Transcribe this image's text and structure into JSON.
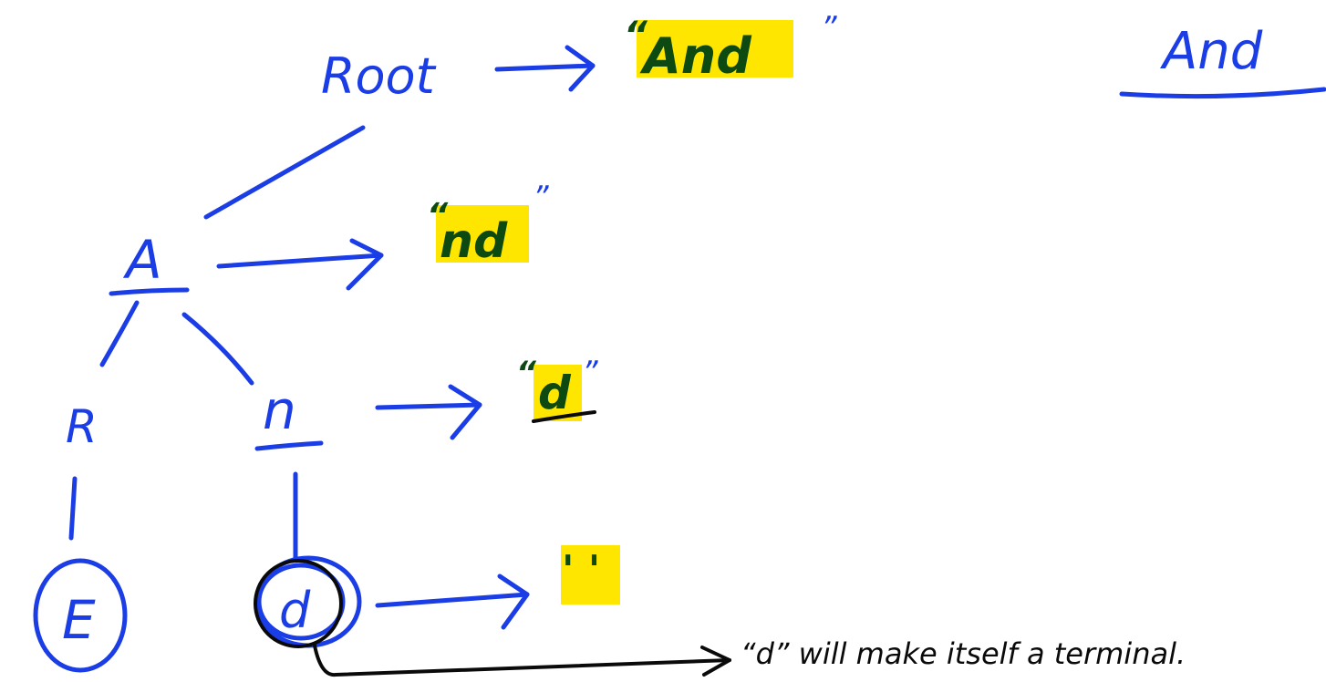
{
  "diagram": {
    "root_label": "Root",
    "root_value": "And",
    "root_quote_open": "“",
    "root_quote_close": "”",
    "heading": "And",
    "node_a": "A",
    "node_a_value": "nd",
    "node_a_quote_open": "“",
    "node_a_quote_close": "”",
    "node_n": "n",
    "node_n_value": "d",
    "node_n_quote_open": "“",
    "node_n_quote_close": "”",
    "node_r": "R",
    "node_e": "E",
    "node_d": "d",
    "node_d_value": "' '",
    "note": "“d” will make itself a terminal."
  },
  "colors": {
    "ink": "#1a3de6",
    "highlight": "#ffe600",
    "highlight_text": "#0c4a12",
    "annotation": "#0a0a0a"
  }
}
